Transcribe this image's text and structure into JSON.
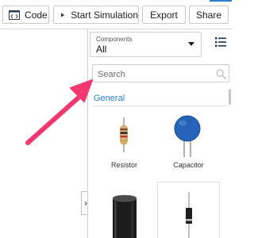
{
  "toolbar": {
    "code_label": "Code",
    "start_simulation_label": "Start Simulation",
    "export_label": "Export",
    "share_label": "Share"
  },
  "components_panel": {
    "dropdown_label": "Components",
    "dropdown_value": "All",
    "search_placeholder": "Search",
    "section_title": "General",
    "items": [
      {
        "label": "Resistor",
        "icon": "resistor-icon"
      },
      {
        "label": "Capacitor",
        "icon": "capacitor-icon"
      },
      {
        "label": "",
        "icon": "electrolytic-capacitor-icon"
      },
      {
        "label": "",
        "icon": "diode-icon"
      }
    ]
  },
  "colors": {
    "accent": "#2a7fd1",
    "annotation_arrow": "#f2386e",
    "capacitor_blue": "#2563b8"
  }
}
